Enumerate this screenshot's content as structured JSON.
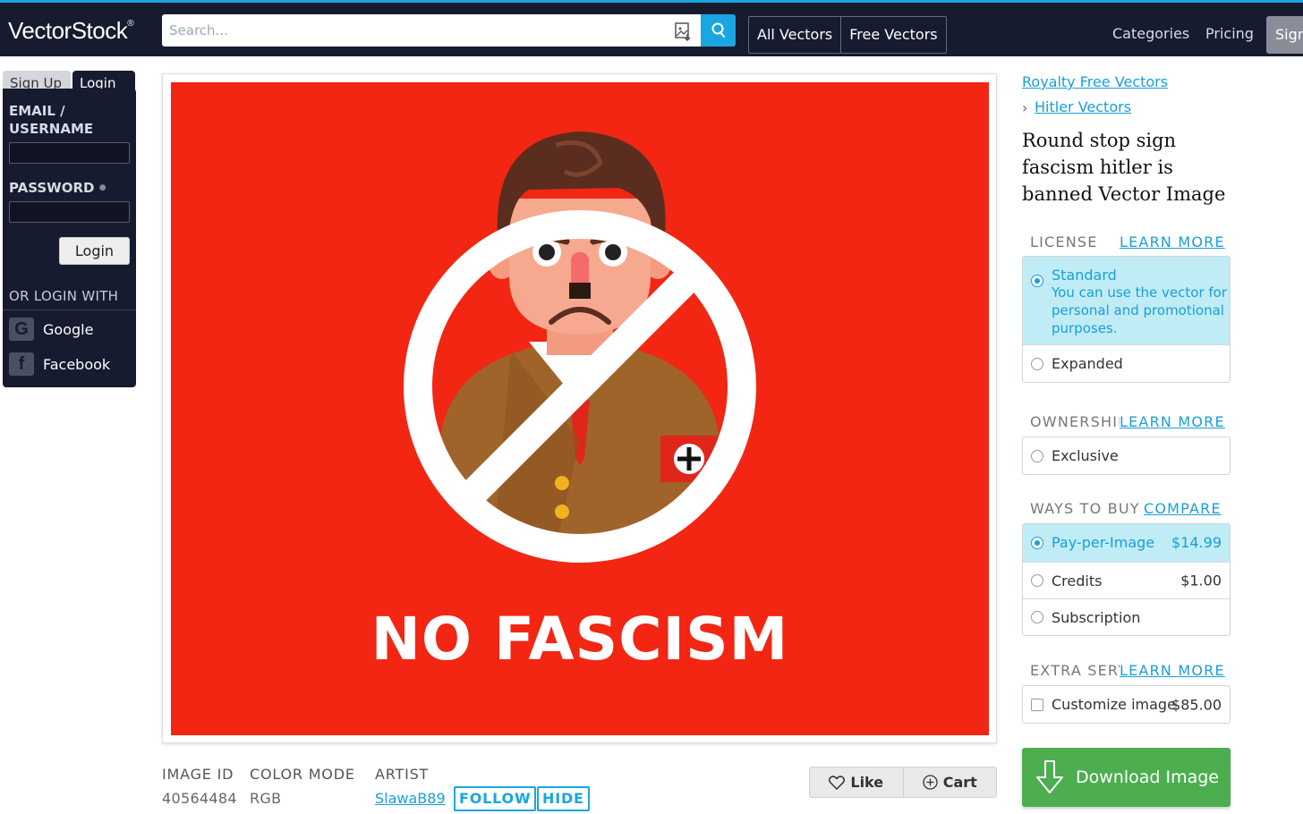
{
  "header": {
    "logo": "VectorStock",
    "logo_mark": "®",
    "search_placeholder": "Search...",
    "tabs": [
      "All Vectors",
      "Free Vectors"
    ],
    "nav": [
      "Categories",
      "Pricing"
    ],
    "signup": "Sign"
  },
  "login": {
    "tab_signup": "Sign Up",
    "tab_login": "Login",
    "email_label_1": "EMAIL /",
    "email_label_2": "USERNAME",
    "password_label": "PASSWORD",
    "login_button": "Login",
    "or_login_with": "OR LOGIN WITH",
    "google": "Google",
    "facebook": "Facebook"
  },
  "image": {
    "caption": "NO FASCISM",
    "background_color": "#f22613"
  },
  "meta": {
    "id_label": "IMAGE ID",
    "id_value": "40564484",
    "color_label": "COLOR MODE",
    "color_value": "RGB",
    "artist_label": "ARTIST",
    "artist_value": "SlawaB89",
    "follow": "FOLLOW",
    "hide": "HIDE",
    "like": "Like",
    "cart": "Cart"
  },
  "sidebar": {
    "crumb_1": "Royalty Free Vectors",
    "crumb_sep": "›",
    "crumb_2": "Hitler Vectors",
    "title": "Round stop sign fascism hitler is banned Vector Image",
    "license_label": "LICENSE",
    "license_link": "LEARN MORE",
    "standard": "Standard",
    "standard_desc": "You can use the vector for personal and promotional purposes.",
    "expanded": "Expanded",
    "ownership_label": "OWNERSHIP",
    "ownership_link": "LEARN MORE",
    "exclusive": "Exclusive",
    "ways_label": "WAYS TO BUY",
    "ways_link": "COMPARE",
    "ppi": "Pay-per-Image",
    "ppi_price": "$14.99",
    "credits": "Credits",
    "credits_price": "$1.00",
    "subscription": "Subscription",
    "extra_label": "EXTRA SERVICES",
    "extra_link": "LEARN MORE",
    "customize": "Customize image",
    "customize_price": "$85.00",
    "download": "Download Image"
  },
  "colors": {
    "header_bg": "#161b30",
    "accent": "#1aa6e0",
    "download_green": "#4cae4f"
  }
}
